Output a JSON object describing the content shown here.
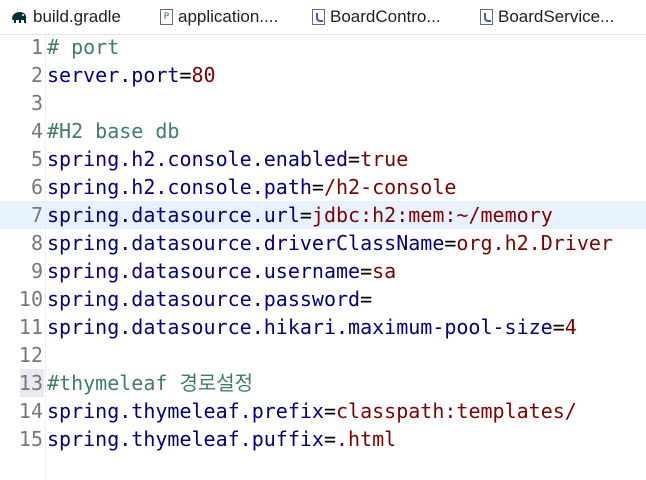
{
  "tabs": [
    {
      "label": "build.gradle",
      "icon": "gradle-elephant-icon"
    },
    {
      "label": "application....",
      "icon": "properties-file-icon",
      "icon_letter": "P"
    },
    {
      "label": "BoardContro...",
      "icon": "java-file-icon"
    },
    {
      "label": "BoardService...",
      "icon": "java-file-icon"
    }
  ],
  "editor": {
    "current_line": 7,
    "lines": [
      {
        "num": "1",
        "key": "# port",
        "eq": "",
        "val": "",
        "comment": true
      },
      {
        "num": "2",
        "key": "server.port",
        "eq": "=",
        "val": "80"
      },
      {
        "num": "3",
        "key": "",
        "eq": "",
        "val": ""
      },
      {
        "num": "4",
        "key": "#H2 base db",
        "eq": "",
        "val": "",
        "comment": true
      },
      {
        "num": "5",
        "key": "spring.h2.console.enabled",
        "eq": "=",
        "val": "true"
      },
      {
        "num": "6",
        "key": "spring.h2.console.path",
        "eq": "=",
        "val": "/h2-console"
      },
      {
        "num": "7",
        "key": "spring.datasource.url",
        "eq": "=",
        "val": "jdbc:h2:mem:~/memory"
      },
      {
        "num": "8",
        "key": "spring.datasource.driverClassName",
        "eq": "=",
        "val": "org.h2.Driver"
      },
      {
        "num": "9",
        "key": "spring.datasource.username",
        "eq": "=",
        "val": "sa"
      },
      {
        "num": "10",
        "key": "spring.datasource.password",
        "eq": "=",
        "val": ""
      },
      {
        "num": "11",
        "key": "spring.datasource.hikari.maximum-pool-size",
        "eq": "=",
        "val": "4"
      },
      {
        "num": "12",
        "key": "",
        "eq": "",
        "val": ""
      },
      {
        "num": "13",
        "key": "#thymeleaf 경로설정",
        "eq": "",
        "val": "",
        "comment": true
      },
      {
        "num": "14",
        "key": "spring.thymeleaf.prefix",
        "eq": "=",
        "val": "classpath:templates/"
      },
      {
        "num": "15",
        "key": "spring.thymeleaf.puffix",
        "eq": "=",
        "val": ".html"
      }
    ]
  },
  "colors": {
    "key": "#000080",
    "value": "#7f0000",
    "comment": "#3f7f5f",
    "current_line_bg": "#e8f2fe"
  }
}
